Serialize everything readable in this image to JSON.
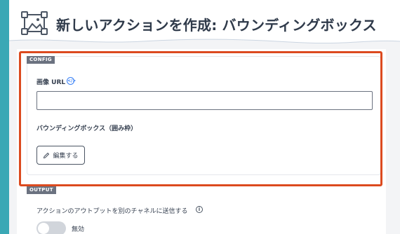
{
  "header": {
    "title": "新しいアクションを作成: バウンディングボックス",
    "logo_icon": "bounding-box-logo-icon"
  },
  "config": {
    "tag": "CONFIG",
    "image_url": {
      "label": "画像 URL",
      "info_icon": "code-info-icon",
      "info_glyph": "</>",
      "value": "",
      "placeholder": ""
    },
    "bounding_box": {
      "label": "バウンディングボックス（囲み枠）",
      "edit_button_label": "編集する",
      "edit_icon": "pencil-icon"
    }
  },
  "output": {
    "tag": "OUTPUT",
    "send_label": "アクションのアウトプットを別のチャネルに送信する",
    "info_icon": "info-icon",
    "info_glyph": "i",
    "toggle_state": "off",
    "toggle_label": "無効"
  },
  "colors": {
    "accent": "#3aa8b5",
    "highlight": "#dc4a1f",
    "tag_bg": "#6b7280",
    "info_blue": "#3b82f6"
  }
}
